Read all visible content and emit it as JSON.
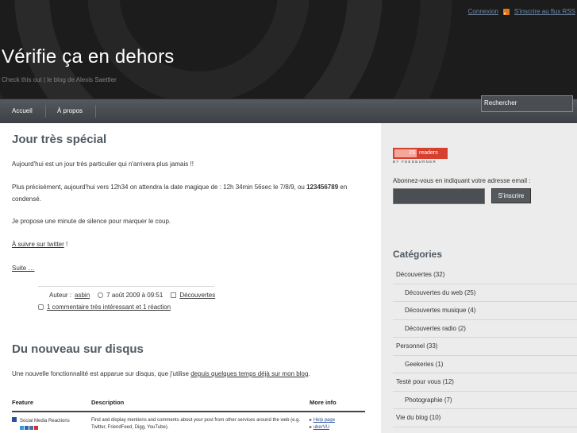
{
  "header": {
    "login_label": "Connexion",
    "rss_label": "S'inscrire au flux RSS",
    "site_title": "Vérifie ça en dehors",
    "site_description": "Check this out | le blog de Alexis Saettler"
  },
  "nav": {
    "items": [
      {
        "label": "Accueil"
      },
      {
        "label": "À propos"
      }
    ],
    "search_placeholder": "Rechercher"
  },
  "post1": {
    "title": "Jour très spécial",
    "p1": "Aujourd'hui est un jour très particulier qui n'arrivera plus jamais !!",
    "p2_before": "Plus précisément, aujourd'hui vers 12h34 on attendra la date magique de : 12h 34min 56sec le 7/8/9, ou ",
    "p2_bold": "123456789",
    "p2_after": " en condensé.",
    "p3": "Je propose une minute de silence pour marquer le coup.",
    "follow_link": "À suivre sur twitter",
    "follow_suffix": " !",
    "more_link": "Suite …",
    "author_prefix": "Auteur : ",
    "author": "asbin",
    "date": "7 août 2009 à 09:51",
    "category": "Découvertes",
    "comments": "1 commentaire très intéressant et 1 réaction"
  },
  "post2": {
    "title": "Du nouveau sur disqus",
    "intro_before": "Une nouvelle fonctionnalité est apparue sur disqus, que j'utilise ",
    "intro_link": "depuis quelques temps déjà sur mon blog",
    "intro_after": ".",
    "table": {
      "headers": [
        "Feature",
        "Description",
        "More info"
      ],
      "row": {
        "feature": "Social Media Reactions",
        "description": "Find and display mentions and comments about your post from other services around the web (e.g. Twitter, FriendFeed, Digg, YouTube).",
        "more1": "Help page",
        "more2": "uberVU"
      }
    }
  },
  "sidebar": {
    "feedburner_count": "23",
    "feedburner_readers": "readers",
    "feedburner_by": "BY FEEDBURNER",
    "subscribe_text": "Abonnez-vous en indiquant votre adresse email :",
    "subscribe_button": "S'inscrire",
    "categories_title": "Catégories",
    "categories": [
      {
        "label": "Découvertes (32)",
        "level": 0
      },
      {
        "label": "Découvertes du web (25)",
        "level": 1
      },
      {
        "label": "Découvertes musique (4)",
        "level": 1
      },
      {
        "label": "Découvertes radio (2)",
        "level": 1
      },
      {
        "label": "Personnel (33)",
        "level": 0
      },
      {
        "label": "Geekeries (1)",
        "level": 1
      },
      {
        "label": "Testé pour vous (12)",
        "level": 0
      },
      {
        "label": "Photographie (7)",
        "level": 1
      },
      {
        "label": "Vie du blog (10)",
        "level": 0
      }
    ]
  },
  "colors": {
    "header_bg": "#1c1c1c",
    "accent_title": "#4f5a63",
    "feedburner_red": "#d7402f",
    "rss_orange": "#e07b1a"
  }
}
